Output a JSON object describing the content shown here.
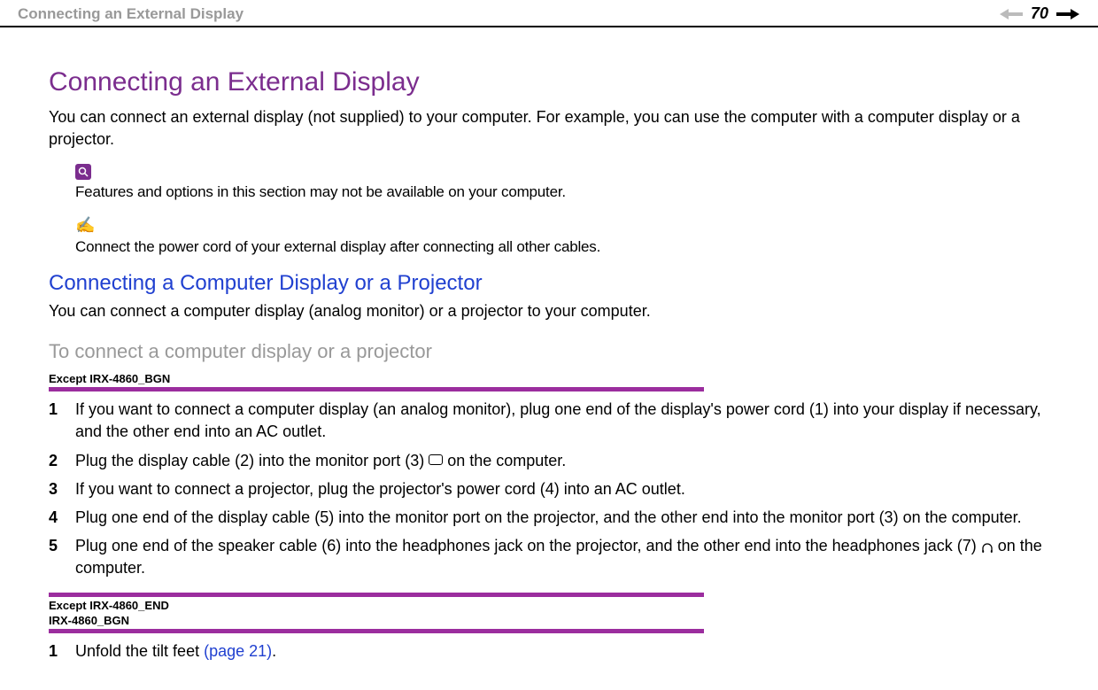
{
  "header": {
    "title": "Connecting an External Display",
    "page_number": "70"
  },
  "main": {
    "h1": "Connecting an External Display",
    "intro": "You can connect an external display (not supplied) to your computer. For example, you can use the computer with a computer display or a projector.",
    "note1": "Features and options in this section may not be available on your computer.",
    "note2": "Connect the power cord of your external display after connecting all other cables.",
    "h2": "Connecting a Computer Display or a Projector",
    "sub_intro": "You can connect a computer display (analog monitor) or a projector to your computer.",
    "h3": "To connect a computer display or a projector",
    "label1": "Except IRX-4860_BGN",
    "steps1": [
      "If you want to connect a computer display (an analog monitor), plug one end of the display's power cord (1) into your display if necessary, and the other end into an AC outlet.",
      "Plug the display cable (2) into the monitor port (3) ▭ on the computer.",
      "If you want to connect a projector, plug the projector's power cord (4) into an AC outlet.",
      "Plug one end of the display cable (5) into the monitor port on the projector, and the other end into the monitor port (3) on the computer.",
      "Plug one end of the speaker cable (6) into the headphones jack on the projector, and the other end into the headphones jack (7) ♫ on the computer."
    ],
    "label2a": "Except IRX-4860_END",
    "label2b": "IRX-4860_BGN",
    "steps2": [
      {
        "pre": "Unfold the tilt feet ",
        "link": "(page 21)",
        "post": "."
      }
    ]
  }
}
